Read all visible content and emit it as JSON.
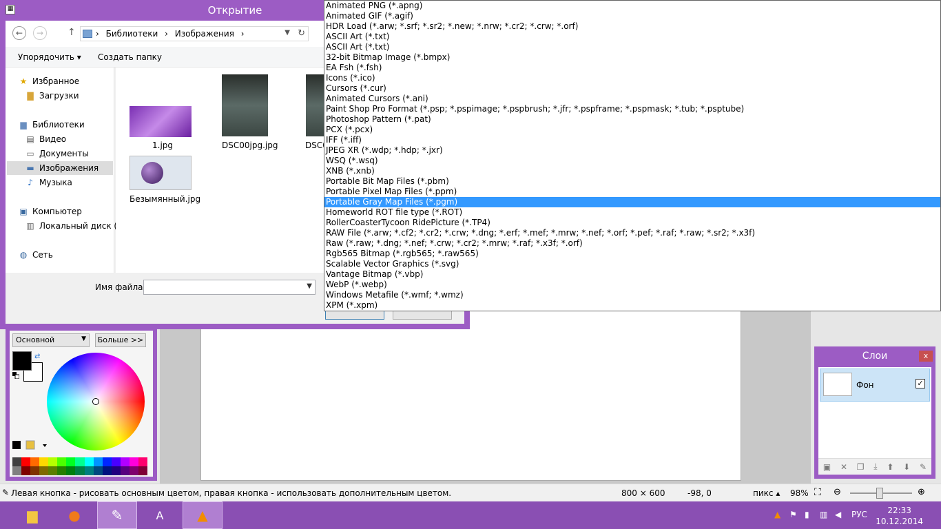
{
  "dialog": {
    "title": "Открытие",
    "nav": {
      "back": "←",
      "forward": "→",
      "up": "↑",
      "path": [
        "Библиотеки",
        "Изображения"
      ],
      "separator": "›"
    },
    "commands": {
      "organize": "Упорядочить ▾",
      "new_folder": "Создать папку"
    },
    "nav_items": [
      {
        "label": "Избранное",
        "icon": "star-icon"
      },
      {
        "label": "Загрузки",
        "icon": "downloads-folder-icon"
      },
      {
        "label": "Библиотеки",
        "icon": "libraries-icon"
      },
      {
        "label": "Видео",
        "icon": "video-library-icon"
      },
      {
        "label": "Документы",
        "icon": "documents-library-icon"
      },
      {
        "label": "Изображения",
        "icon": "pictures-library-icon"
      },
      {
        "label": "Музыка",
        "icon": "music-library-icon"
      },
      {
        "label": "Компьютер",
        "icon": "computer-icon"
      },
      {
        "label": "Локальный диск (C",
        "icon": "disk-icon"
      },
      {
        "label": "Сеть",
        "icon": "network-icon"
      }
    ],
    "files": [
      {
        "name": "1.jpg"
      },
      {
        "name": "DSC00jpg.jpg"
      },
      {
        "name": "DSC0"
      },
      {
        "name": "Безымянный.jpg"
      }
    ],
    "filename_label": "Имя файла:",
    "filename_value": ""
  },
  "file_types": [
    "Animated PNG (*.apng)",
    "Animated GIF (*.agif)",
    "HDR Load (*.arw; *.srf; *.sr2; *.new; *.nrw; *.cr2; *.crw; *.orf)",
    "ASCII Art (*.txt)",
    "ASCII Art (*.txt)",
    "32-bit Bitmap Image (*.bmpx)",
    "EA Fsh (*.fsh)",
    "Icons (*.ico)",
    "Cursors (*.cur)",
    "Animated Cursors (*.ani)",
    "Paint Shop Pro Format (*.psp; *.pspimage; *.pspbrush; *.jfr; *.pspframe; *.pspmask; *.tub; *.psptube)",
    "Photoshop Pattern (*.pat)",
    "PCX (*.pcx)",
    "IFF (*.iff)",
    "JPEG XR (*.wdp; *.hdp; *.jxr)",
    "WSQ (*.wsq)",
    "XNB (*.xnb)",
    "Portable Bit Map Files (*.pbm)",
    "Portable Pixel Map Files (*.ppm)",
    "Portable Gray Map Files (*.pgm)",
    "Homeworld ROT file type (*.ROT)",
    "RollerCoasterTycoon RidePicture (*.TP4)",
    "RAW File (*.arw; *.cf2; *.cr2; *.crw; *.dng; *.erf; *.mef; *.mrw; *.nef; *.orf; *.pef; *.raf; *.raw; *.sr2; *.x3f)",
    "Raw (*.raw; *.dng; *.nef; *.crw; *.cr2; *.mrw; *.raf; *.x3f; *.orf)",
    "Rgb565 Bitmap (*.rgb565; *.raw565)",
    "Scalable Vector Graphics (*.svg)",
    "Vantage Bitmap (*.vbp)",
    "WebP (*.webp)",
    "Windows Metafile (*.wmf; *.wmz)",
    "XPM (*.xpm)"
  ],
  "file_types_selected": "Portable Gray Map Files (*.pgm)",
  "colors": {
    "mode": "Основной",
    "more": "Больше >>",
    "primary": "#000000",
    "secondary": "#ffffff",
    "palette_top": [
      "#404040",
      "#ff0000",
      "#ff6a00",
      "#ffd800",
      "#b6ff00",
      "#4cff00",
      "#00ff21",
      "#00ff90",
      "#00ffff",
      "#0094ff",
      "#0026ff",
      "#4800ff",
      "#b200ff",
      "#ff00dc",
      "#ff006e"
    ],
    "palette_bottom": [
      "#808080",
      "#7f0000",
      "#7f3300",
      "#7f6a00",
      "#5b7f00",
      "#267f00",
      "#007f0e",
      "#007f46",
      "#007f7f",
      "#004a7f",
      "#00137f",
      "#21007f",
      "#57007f",
      "#7f006e",
      "#7f0037"
    ]
  },
  "layers": {
    "title": "Слои",
    "close": "x",
    "layer_name": "Фон",
    "visible_check": "✓"
  },
  "status": {
    "hint": "Левая кнопка - рисовать основным цветом, правая кнопка - использовать дополнительным цветом.",
    "size": "800 × 600",
    "position": "-98, 0",
    "unit": "пикс",
    "unit_arrow": "▴",
    "zoom": "98%"
  },
  "taskbar": {
    "lang": "РУС",
    "time": "22:33",
    "date": "10.12.2014"
  },
  "accent": "#8a4fb3"
}
